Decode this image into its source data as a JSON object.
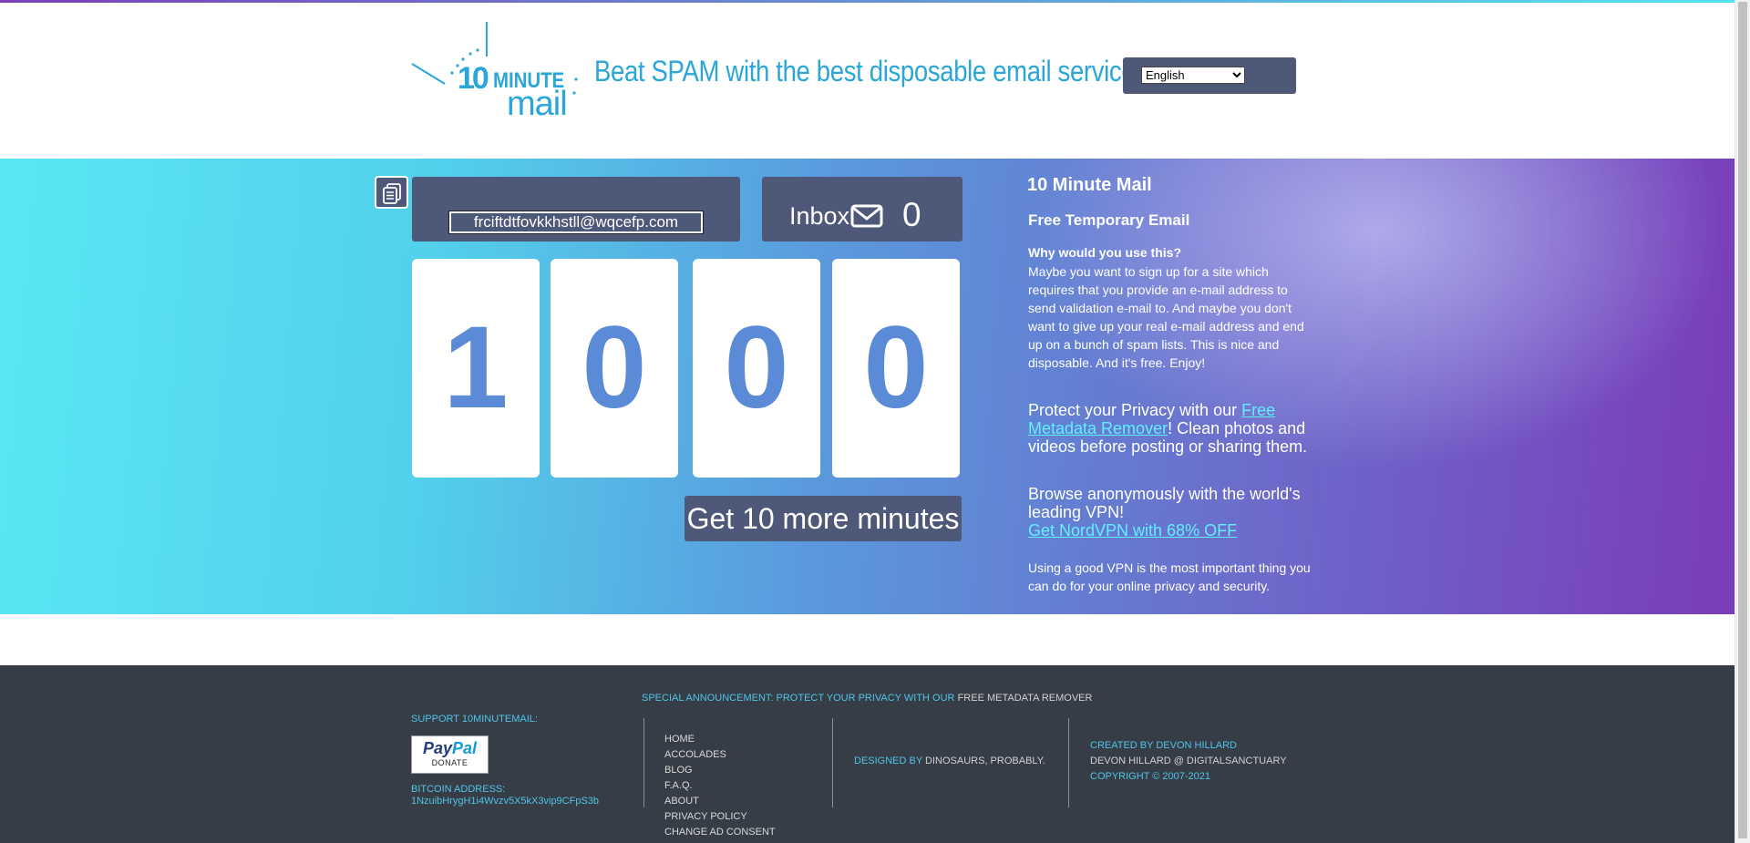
{
  "header": {
    "logo_text": "10 MINUTE mail",
    "tagline": "Beat SPAM with the best disposable email service",
    "language": {
      "selected": "English",
      "options": [
        "English"
      ]
    }
  },
  "mailbox": {
    "copy_icon": "clipboard-copy-icon",
    "email_address": "frciftdtfovkkhstll@wqcefp.com",
    "inbox_label": "Inbox",
    "inbox_icon": "envelope-icon",
    "inbox_count": "0"
  },
  "timer": {
    "digits": [
      "1",
      "0",
      "0",
      "0"
    ],
    "more_button": "Get 10 more minutes"
  },
  "sidebar": {
    "title": "10 Minute Mail",
    "subtitle": "Free Temporary Email",
    "why_heading": "Why would you use this?",
    "why_text": "Maybe you want to sign up for a site which requires that you provide an e-mail address to send validation e-mail to. And maybe you don't want to give up your real e-mail address and end up on a bunch of spam lists. This is nice and disposable. And it's free. Enjoy!",
    "privacy_prefix": "Protect your Privacy with our ",
    "privacy_link": "Free Metadata Remover",
    "privacy_suffix": "! Clean photos and videos before posting or sharing them.",
    "vpn_text": "Browse anonymously with the world's leading VPN!",
    "vpn_link": "Get NordVPN with 68% OFF",
    "vpn_note": "Using a good VPN is the most important thing you can do for your online privacy and security."
  },
  "footer": {
    "announce_prefix": "SPECIAL ANNOUNCEMENT: PROTECT YOUR PRIVACY WITH OUR ",
    "announce_link": "FREE METADATA REMOVER",
    "support_label": "SUPPORT 10MINUTEMAIL:",
    "paypal_brand_a": "Pay",
    "paypal_brand_b": "Pal",
    "paypal_donate": "DONATE",
    "bitcoin_label": "BITCOIN ADDRESS:",
    "bitcoin_address": "1NzuibHrygH1i4Wvzv5X5kX3vip9CFpS3b",
    "nav": [
      "HOME",
      "ACCOLADES",
      "BLOG",
      "F.A.Q.",
      "ABOUT",
      "PRIVACY POLICY",
      "CHANGE AD CONSENT"
    ],
    "designed_prefix": "DESIGNED BY ",
    "designed_by": "DINOSAURS, PROBABLY.",
    "created_by": "CREATED BY DEVON HILLARD",
    "author_handle": "DEVON HILLARD @ DIGITALSANCTUARY",
    "copyright": "COPYRIGHT © 2007-2021"
  },
  "colors": {
    "panel": "#4e5878",
    "digit": "#5b8ad6",
    "tagline": "#2aa6d8",
    "footer_bg": "#373d46",
    "footer_accent": "#4fc4e8",
    "link": "#5ef0ff"
  }
}
